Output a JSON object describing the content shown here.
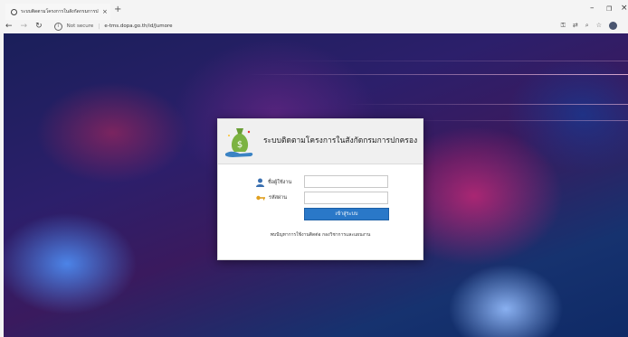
{
  "browser": {
    "tab_title": "ระบบติดตามโครงการในสังกัดกรมการปกครอง",
    "tab_close": "×",
    "new_tab": "+",
    "security_label": "Not secure",
    "separator": "|",
    "url": "e-tms.dopa.go.th/id/Jumore",
    "window_controls": {
      "minimize": "–",
      "maximize": "❐",
      "close": "×"
    },
    "icons": [
      "key-icon",
      "translate-icon",
      "zoom-icon",
      "star-icon",
      "profile-avatar"
    ]
  },
  "login": {
    "title": "ระบบติดตามโครงการในสังกัดกรมการปกครอง",
    "username_label": "ชื่อผู้ใช้งาน",
    "username_value": "",
    "password_label": "รหัสผ่าน",
    "password_value": "",
    "submit_label": "เข้าสู่ระบบ",
    "footer": "พบปัญหาการใช้งานติดต่อ กองวิชาการและแผนงาน"
  },
  "colors": {
    "button": "#2a78c8",
    "card_header": "#f0f0f0",
    "logo_bag": "#7cb342",
    "page_background": "#2c1f6b"
  }
}
